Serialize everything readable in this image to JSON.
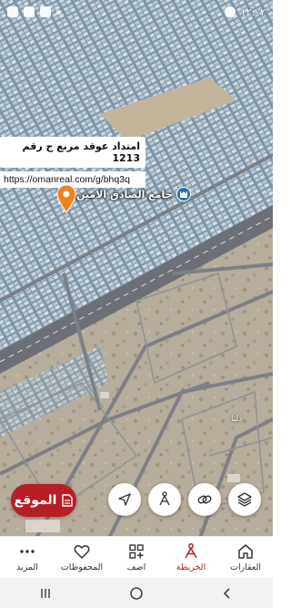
{
  "status_bar": {
    "time": "١٢:٠٢"
  },
  "listing": {
    "title": "امتداد عوقد مربع ج رقم 1213",
    "url": "https://omanreal.com/g/bhq3q"
  },
  "map": {
    "poi_label": "جامع الصادق الامين",
    "poi_icon": "mosque-icon",
    "small_label": "دلتا"
  },
  "actions": {
    "location_label": "الموقع",
    "buttons": [
      {
        "name": "navigate-icon"
      },
      {
        "name": "draw-area-icon"
      },
      {
        "name": "link-icon"
      },
      {
        "name": "layers-icon"
      }
    ]
  },
  "bottom_nav": {
    "items": [
      {
        "label": "العقارات",
        "icon": "home-icon"
      },
      {
        "label": "الخريطة",
        "icon": "map-icon",
        "active": true
      },
      {
        "label": "اضف",
        "icon": "add-icon"
      },
      {
        "label": "المحفوظات",
        "icon": "heart-icon"
      },
      {
        "label": "المزيد",
        "icon": "more-icon"
      }
    ]
  },
  "colors": {
    "accent": "#b61f24",
    "pin": "#f0811c",
    "poi": "#1f6fb8"
  }
}
